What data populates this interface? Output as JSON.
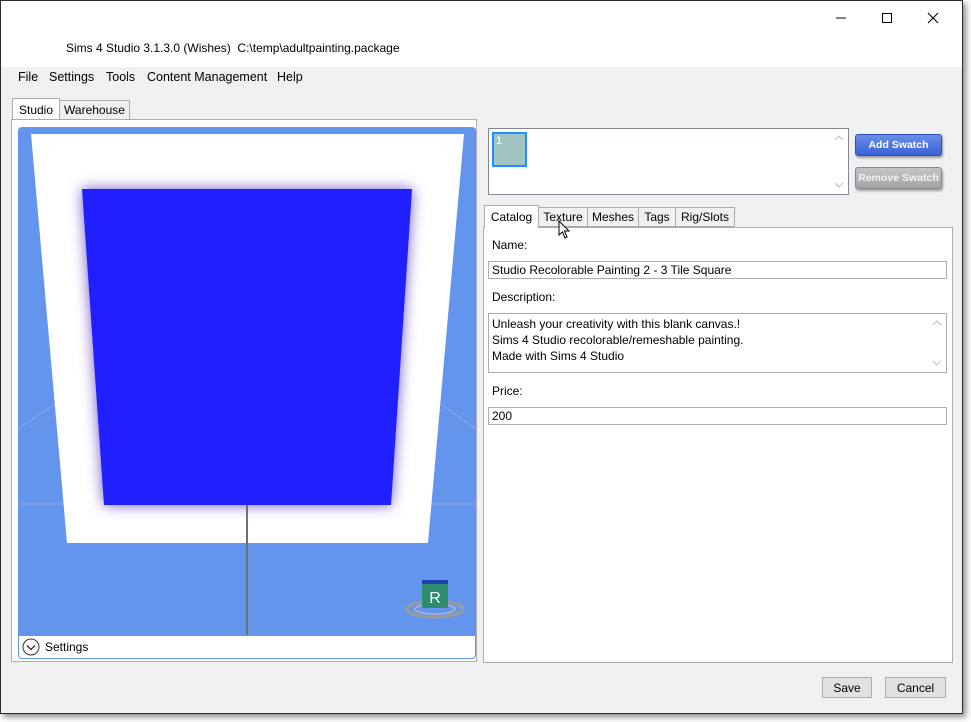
{
  "window": {
    "title": "Sims 4 Studio 3.1.3.0 (Wishes)  C:\\temp\\adultpainting.package",
    "minimize_glyph": "—",
    "maximize_glyph": "☐",
    "close_glyph": "✕"
  },
  "menu": {
    "items": [
      "File",
      "Settings",
      "Tools",
      "Content Management",
      "Help"
    ]
  },
  "outer_tabs": [
    {
      "label": "Studio",
      "active": true
    },
    {
      "label": "Warehouse",
      "active": false
    }
  ],
  "viewport": {
    "background_color": "#6495ed",
    "canvas_color": "#1f1fff",
    "rotate_gizmo_letter": "R",
    "settings_label": "Settings"
  },
  "swatches": {
    "items": [
      {
        "label": "1",
        "color": "#a2c3c3",
        "selected": true
      }
    ],
    "add_label": "Add Swatch",
    "remove_label": "Remove Swatch"
  },
  "inner_tabs": [
    {
      "label": "Catalog",
      "active": true
    },
    {
      "label": "Texture",
      "active": false
    },
    {
      "label": "Meshes",
      "active": false
    },
    {
      "label": "Tags",
      "active": false
    },
    {
      "label": "Rig/Slots",
      "active": false
    }
  ],
  "catalog": {
    "name_label": "Name:",
    "name_value": "Studio Recolorable Painting 2 - 3 Tile Square",
    "description_label": "Description:",
    "description_lines": [
      "Unleash your creativity with this blank canvas.!",
      "Sims 4 Studio recolorable/remeshable painting.",
      "Made with Sims 4 Studio"
    ],
    "price_label": "Price:",
    "price_value": "200"
  },
  "footer": {
    "save_label": "Save",
    "cancel_label": "Cancel"
  }
}
